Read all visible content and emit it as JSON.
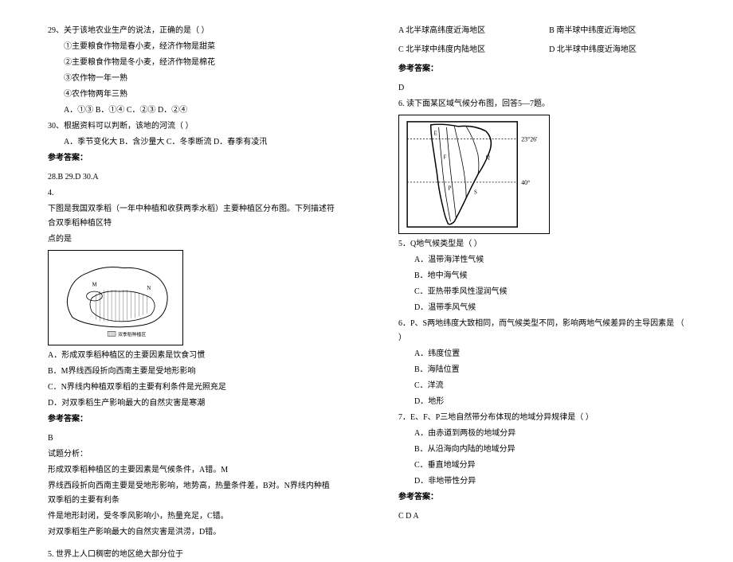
{
  "left": {
    "q29": {
      "stem": "29、关于该地农业生产的说法，正确的是（        ）",
      "s1": "①主要粮食作物是春小麦，经济作物是甜菜",
      "s2": "②主要粮食作物是冬小麦，经济作物是棉花",
      "s3": "③农作物一年一熟",
      "s4": "④农作物两年三熟",
      "opts": "A．①③      B．①④      C．②③      D．②④"
    },
    "q30": {
      "stem": "30、根据资料可以判断，该地的河流（        ）",
      "opts": "A．季节变化大   B．含沙量大    C．冬季断流    D．春季有凌汛"
    },
    "ansLabel": "参考答案：",
    "ans2830": "28.B   29.D   30.A",
    "q4num": "4.",
    "q4stem1": "下图是我国双季稻（一年中种植和收获两季水稻）主要种植区分布图。下列描述符合双季稻种植区特",
    "q4stem2": "点的是",
    "mapLabel": "双季稻种植区",
    "q4a": "A．形成双季稻种植区的主要因素是饮食习惯",
    "q4b": "B．M界线西段折向西南主要是受地形影响",
    "q4c": "C．N界线内种植双季稻的主要有利条件是光照充足",
    "q4d": "D．对双季稻生产影响最大的自然灾害是寒潮",
    "ans4": "B",
    "explLabel": "试题分析：",
    "expl1": "形成双季稻种植区的主要因素是气候条件，A错。M",
    "expl2": "界线西段折向西南主要是受地形影响，地势高，热量条件差，B对。N界线内种植双季稻的主要有利条",
    "expl3": "件是地形封闭，受冬季风影响小，热量充足，C错。",
    "expl4": "对双季稻生产影响最大的自然灾害是洪涝，D错。",
    "q5": "5. 世界上人口稠密的地区绝大部分位于"
  },
  "right": {
    "q5opts": {
      "a": "A  北半球高纬度近海地区",
      "b": "B  南半球中纬度近海地区",
      "c": "C  北半球中纬度内陆地区",
      "d": "D  北半球中纬度近海地区"
    },
    "ansLabel": "参考答案：",
    "ans5": "D",
    "q6": "6. 读下面某区域气候分布图，回答5—7题。",
    "lat1": "23°26'",
    "lat2": "40°",
    "q5sub": {
      "stem": "5．Q地气候类型是（    ）",
      "a": "A．温带海洋性气候",
      "b": "B．地中海气候",
      "c": "C．亚热带季风性湿润气候",
      "d": "D．温带季风气候"
    },
    "q6sub": {
      "stem": "6．P、S两地纬度大致相同，而气候类型不同，影响两地气候差异的主导因素是    （     ）",
      "a": "A．纬度位置",
      "b": "B．海陆位置",
      "c": "C．洋流",
      "d": "D．地形"
    },
    "q7sub": {
      "stem": "7．E、F、P三地自然带分布体现的地域分异规律是（    ）",
      "a": "A．由赤道到两极的地域分异",
      "b": "B．从沿海向内陆的地域分异",
      "c": "C．垂直地域分异",
      "d": "D．非地带性分异"
    },
    "ans67": "C  D  A"
  }
}
